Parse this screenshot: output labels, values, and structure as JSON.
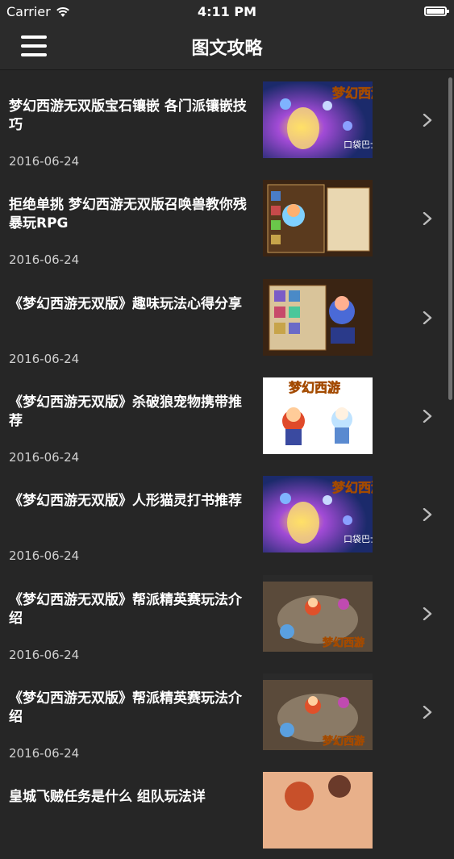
{
  "status_bar": {
    "carrier": "Carrier",
    "time": "4:11 PM",
    "wifi_icon": "wifi-icon",
    "battery_icon": "battery-icon"
  },
  "nav": {
    "title": "图文攻略",
    "menu_icon": "hamburger-menu-icon"
  },
  "colors": {
    "background": "#262626",
    "bar": "#2b2b2b",
    "text": "#ffffff",
    "date": "#d0d0d0"
  },
  "articles": [
    {
      "title": "梦幻西游无双版宝石镶嵌 各门派镶嵌技巧",
      "date": "2016-06-24",
      "thumb_style": "battle-night",
      "thumb_logo": "梦幻西游",
      "thumb_watermark": "口袋巴士"
    },
    {
      "title": "拒绝单挑 梦幻西游无双版召唤兽教你残暴玩RPG",
      "date": "2016-06-24",
      "thumb_style": "menu-screen"
    },
    {
      "title": "《梦幻西游无双版》趣味玩法心得分享",
      "date": "2016-06-24",
      "thumb_style": "inventory-screen"
    },
    {
      "title": "《梦幻西游无双版》杀破狼宠物携带推荐",
      "date": "2016-06-24",
      "thumb_style": "characters-white",
      "thumb_logo": "梦幻西游"
    },
    {
      "title": "《梦幻西游无双版》人形猫灵打书推荐",
      "date": "2016-06-24",
      "thumb_style": "battle-night",
      "thumb_logo": "梦幻西游",
      "thumb_watermark": "口袋巴士"
    },
    {
      "title": "《梦幻西游无双版》帮派精英赛玩法介绍",
      "date": "2016-06-24",
      "thumb_style": "arena",
      "thumb_logo": "梦幻西游"
    },
    {
      "title": "《梦幻西游无双版》帮派精英赛玩法介绍",
      "date": "2016-06-24",
      "thumb_style": "arena",
      "thumb_logo": "梦幻西游"
    },
    {
      "title": "皇城飞贼任务是什么 组队玩法详",
      "date": "",
      "thumb_style": "partial-art"
    }
  ]
}
